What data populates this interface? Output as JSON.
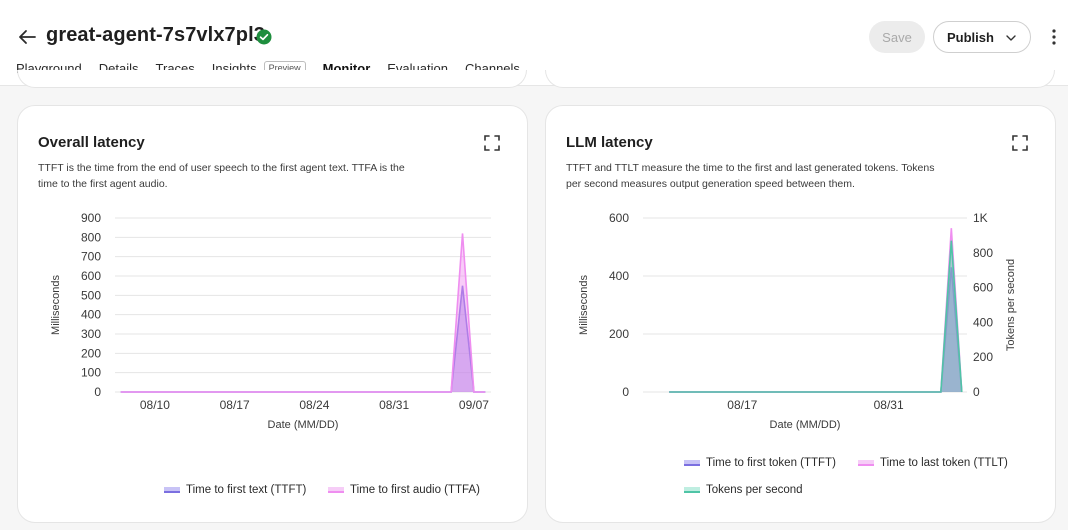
{
  "header": {
    "title": "great-agent-7s7vlx7pl3",
    "save_label": "Save",
    "publish_label": "Publish"
  },
  "tabs": [
    {
      "label": "Playground"
    },
    {
      "label": "Details"
    },
    {
      "label": "Traces"
    },
    {
      "label": "Insights",
      "badge": "Preview"
    },
    {
      "label": "Monitor",
      "active": true
    },
    {
      "label": "Evaluation"
    },
    {
      "label": "Channels"
    }
  ],
  "cards": {
    "overall": {
      "title": "Overall latency",
      "description": "TTFT is the time from the end of user speech to the first agent text. TTFA is the time to the first agent audio."
    },
    "llm": {
      "title": "LLM latency",
      "description": "TTFT and TTLT measure the time to the first and last generated tokens. Tokens per second measures output generation speed between them."
    }
  },
  "chart_data": [
    {
      "type": "area",
      "title": "Overall latency",
      "xlabel": "Date (MM/DD)",
      "ylabel": "Milliseconds",
      "ylim": [
        0,
        900
      ],
      "yticks": [
        0,
        100,
        200,
        300,
        400,
        500,
        600,
        700,
        800,
        900
      ],
      "xticks": [
        "08/10",
        "08/17",
        "08/24",
        "08/31",
        "09/07"
      ],
      "x": [
        "08/07",
        "08/10",
        "08/17",
        "08/24",
        "08/31",
        "09/05",
        "09/06",
        "09/07",
        "09/08"
      ],
      "series": [
        {
          "name": "Time to first text (TTFT)",
          "color": "#7b6fe0",
          "values": [
            0,
            0,
            0,
            0,
            0,
            0,
            550,
            0,
            0
          ]
        },
        {
          "name": "Time to first audio (TTFA)",
          "color": "#ef8ef0",
          "values": [
            0,
            0,
            0,
            0,
            0,
            0,
            820,
            0,
            0
          ]
        }
      ],
      "grid": true,
      "legend": "bottom"
    },
    {
      "type": "area",
      "title": "LLM latency",
      "xlabel": "Date (MM/DD)",
      "ylabel": "Milliseconds",
      "ylabel_right": "Tokens per second",
      "ylim": [
        0,
        600
      ],
      "yticks": [
        0,
        200,
        400,
        600
      ],
      "ylim_right": [
        0,
        1000
      ],
      "yticks_right": [
        "0",
        "200",
        "400",
        "600",
        "800",
        "1K"
      ],
      "xticks": [
        "08/17",
        "08/31"
      ],
      "x": [
        "08/10",
        "08/17",
        "08/31",
        "09/05",
        "09/06",
        "09/07"
      ],
      "series": [
        {
          "name": "Time to first token (TTFT)",
          "color": "#7b6fe0",
          "axis": "left",
          "values": [
            0,
            0,
            0,
            0,
            430,
            0
          ]
        },
        {
          "name": "Time to last token (TTLT)",
          "color": "#ef8ef0",
          "axis": "left",
          "values": [
            0,
            0,
            0,
            0,
            565,
            0
          ]
        },
        {
          "name": "Tokens per second",
          "color": "#4fc4a6",
          "axis": "right",
          "values": [
            0,
            0,
            0,
            0,
            870,
            0
          ]
        }
      ],
      "grid": true,
      "legend": "bottom"
    }
  ],
  "colors": {
    "accent": "#5b45c9",
    "success": "#1e8e3e"
  },
  "icons": [
    "back-arrow-icon",
    "verified-check-icon",
    "chevron-down-icon",
    "kebab-menu-icon",
    "expand-icon"
  ]
}
